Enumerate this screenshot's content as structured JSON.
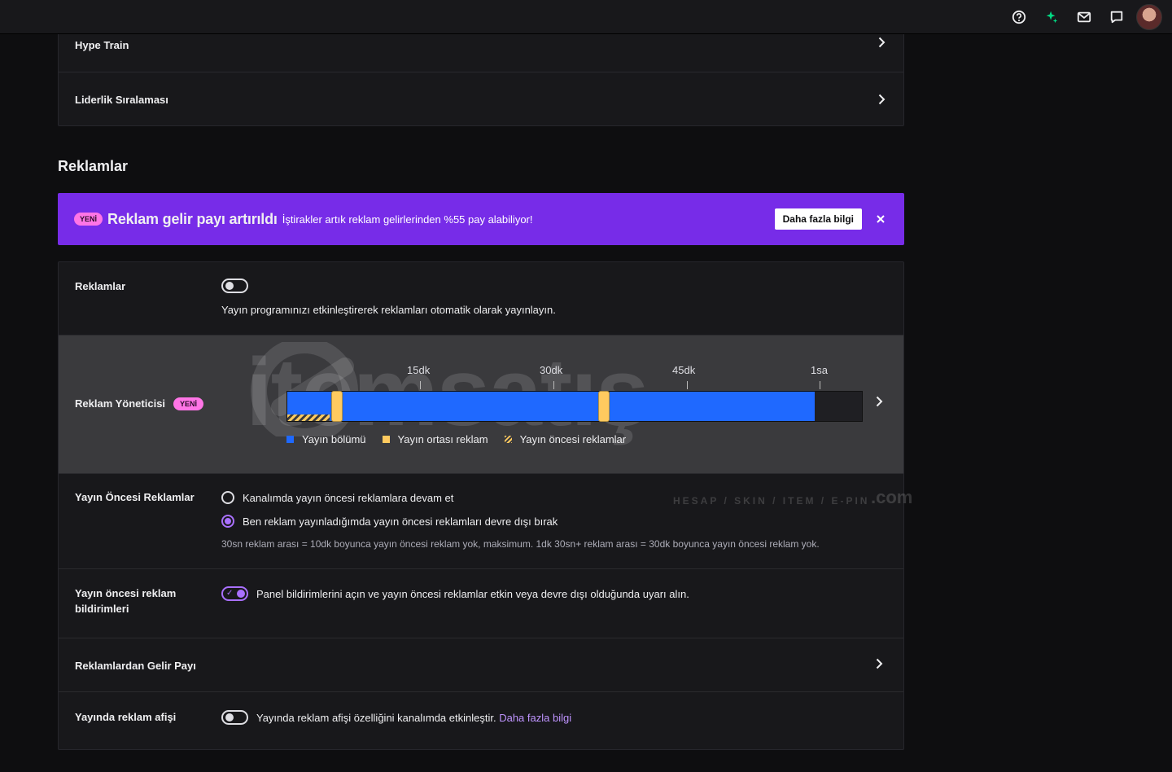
{
  "topbar": {
    "icons": [
      "help-icon",
      "crown-sparkle-icon",
      "inbox-icon",
      "whispers-icon",
      "avatar"
    ]
  },
  "top_card": {
    "rows": [
      {
        "label": "Hype Train"
      },
      {
        "label": "Liderlik Sıralaması"
      }
    ]
  },
  "ads_section": {
    "title": "Reklamlar"
  },
  "banner": {
    "badge": "YENİ",
    "title": "Reklam gelir payı artırıldı",
    "text": "İştirakler artık reklam gelirlerinden %55 pay alabiliyor!",
    "button": "Daha fazla bilgi",
    "bg_color": "#772ce8"
  },
  "settings": {
    "ads_toggle": {
      "label": "Reklamlar",
      "enabled": false,
      "description": "Yayın programınızı etkinleştirerek reklamları otomatik olarak yayınlayın."
    },
    "ad_manager": {
      "label": "Reklam Yöneticisi",
      "badge": "YENİ",
      "ticks": [
        "15dk",
        "30dk",
        "45dk",
        "1sa"
      ],
      "legend": [
        {
          "label": "Yayın bölümü",
          "color": "#1f69ff"
        },
        {
          "label": "Yayın ortası reklam",
          "color": "#ffca5f"
        },
        {
          "label": "Yayın öncesi reklamlar",
          "color": "#ffca5f"
        }
      ],
      "watermark": {
        "brand": "itemsatış",
        "tagline": "HESAP / SKIN / ITEM / E-PIN",
        "suffix": ".com"
      }
    },
    "preroll": {
      "label": "Yayın Öncesi Reklamlar",
      "options": [
        {
          "label": "Kanalımda yayın öncesi reklamlara devam et",
          "selected": false
        },
        {
          "label": "Ben reklam yayınladığımda yayın öncesi reklamları devre dışı bırak",
          "selected": true
        }
      ],
      "helper": "30sn reklam arası = 10dk boyunca yayın öncesi reklam yok, maksimum. 1dk 30sn+ reklam arası = 30dk boyunca yayın öncesi reklam yok."
    },
    "preroll_notifications": {
      "label": "Yayın öncesi reklam bildirimleri",
      "enabled": true,
      "description": "Panel bildirimlerini açın ve yayın öncesi reklamlar etkin veya devre dışı olduğunda uyarı alın."
    },
    "revenue_share": {
      "label": "Reklamlardan Gelir Payı"
    },
    "ad_poster": {
      "label": "Yayında reklam afişi",
      "enabled": false,
      "description": "Yayında reklam afişi özelliğini kanalımda etkinleştir.",
      "link": "Daha fazla bilgi"
    }
  }
}
